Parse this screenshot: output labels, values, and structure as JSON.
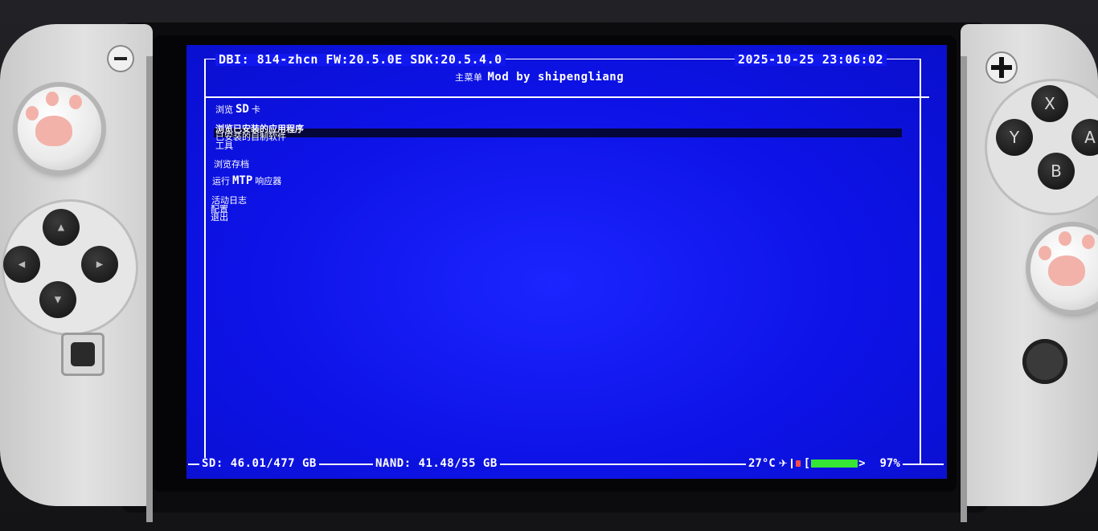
{
  "header": {
    "app_info": "DBI: 814-zhcn FW:20.5.0E SDK:20.5.4.0",
    "datetime": "2025-10-25 23:06:02"
  },
  "subtitle": {
    "menu_name": "主菜单",
    "mod_credit": "Mod by shipengliang"
  },
  "menu": {
    "items": [
      {
        "prefix": "浏览",
        "bold": "SD",
        "suffix": "卡"
      },
      {
        "label": "浏览已安装的应用程序",
        "selected": true
      },
      {
        "label": "已安装的自制软件"
      },
      {
        "label": "工具"
      },
      {
        "label": "浏览存档"
      },
      {
        "prefix": "运行",
        "bold": "MTP",
        "suffix": "响应器"
      },
      {
        "label": "活动日志"
      },
      {
        "label": "配置"
      },
      {
        "label": "退出"
      }
    ]
  },
  "footer": {
    "sd": "SD: 46.01/477 GB",
    "nand": "NAND: 41.48/55 GB",
    "temperature": "27°C",
    "battery": "97%",
    "airplane_icon": "airplane-icon",
    "lock_icon": "lock-icon",
    "battery_icon": "battery-icon",
    "battery_color": "#35e635"
  },
  "colors": {
    "screen_bg": "#0d13e6",
    "text": "#ffffff",
    "selection": "#05063a"
  }
}
